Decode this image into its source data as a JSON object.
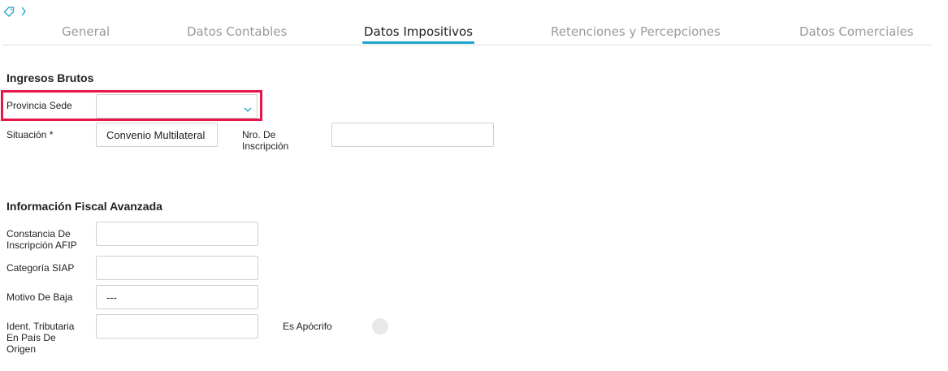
{
  "header": {
    "tag_icon": "tag-icon",
    "chevron_icon": "chevron-right-icon"
  },
  "tabs": [
    {
      "label": "General"
    },
    {
      "label": "Datos Contables"
    },
    {
      "label": "Datos Impositivos"
    },
    {
      "label": "Retenciones y Percepciones"
    },
    {
      "label": "Datos Comerciales"
    }
  ],
  "active_tab": "Datos Impositivos",
  "ingresos": {
    "title": "Ingresos Brutos",
    "provincia_label": "Provincia Sede",
    "provincia_value": "",
    "situacion_label": "Situación *",
    "situacion_value": "Convenio Multilateral",
    "nro_label_1": "Nro. De",
    "nro_label_2": "Inscripción",
    "nro_value": ""
  },
  "fiscal": {
    "title": "Información Fiscal Avanzada",
    "constancia_label_1": "Constancia De",
    "constancia_label_2": "Inscripción AFIP",
    "constancia_value": "",
    "categoria_label": "Categoría SIAP",
    "categoria_value": "",
    "motivo_label": "Motivo De Baja",
    "motivo_value": "---",
    "ident_label_1": "Ident. Tributaria",
    "ident_label_2": "En País De",
    "ident_label_3": "Origen",
    "ident_value": "",
    "apocrifo_label": "Es Apócrifo"
  },
  "colors": {
    "accent": "#1fa3c9",
    "highlight": "#e5174a"
  }
}
